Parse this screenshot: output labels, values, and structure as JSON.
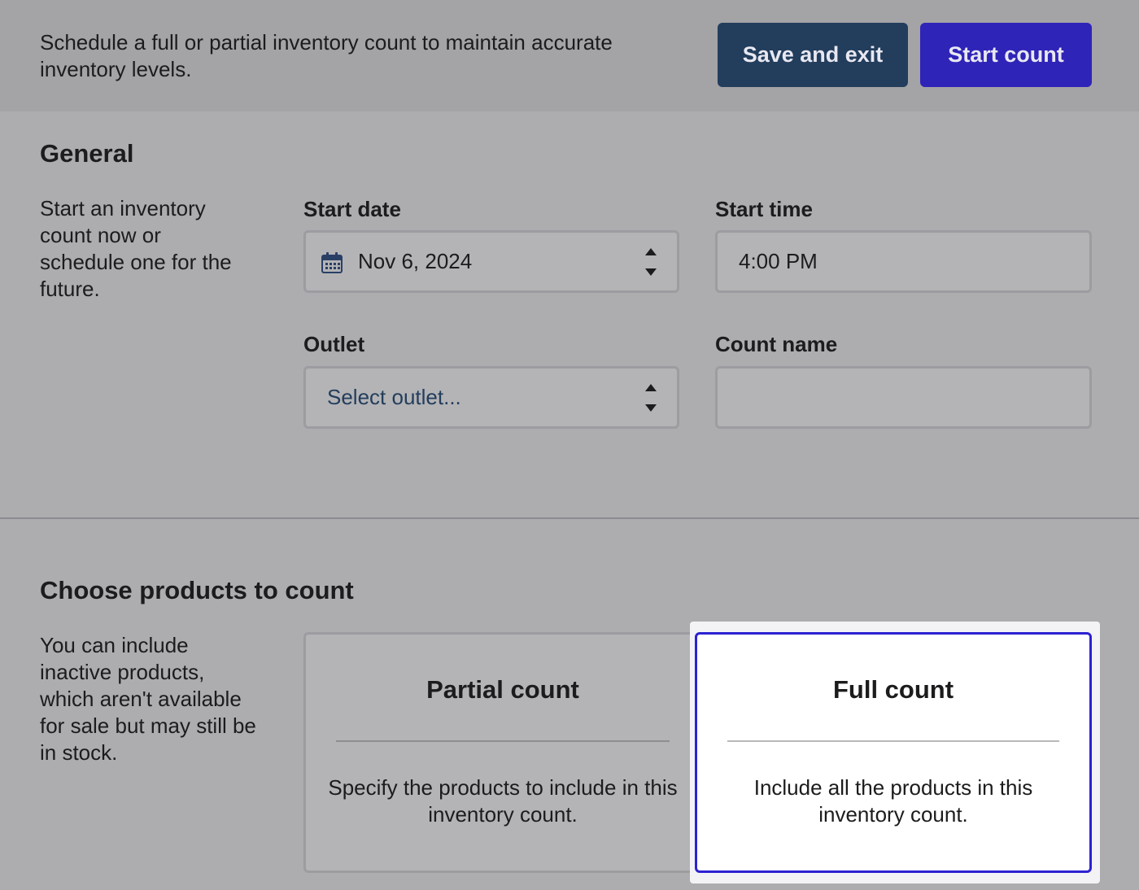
{
  "header": {
    "description": "Schedule a full or partial inventory count to maintain accurate inventory levels.",
    "save_exit_label": "Save and exit",
    "start_count_label": "Start count",
    "save_color": "#233d5c",
    "start_color": "#2f24b8"
  },
  "general": {
    "title": "General",
    "description": "Start an inventory count now or schedule one for the future.",
    "start_date": {
      "label": "Start date",
      "value": "Nov 6, 2024",
      "icon": "calendar-icon"
    },
    "start_time": {
      "label": "Start time",
      "value": "4:00 PM"
    },
    "outlet": {
      "label": "Outlet",
      "placeholder": "Select outlet..."
    },
    "count_name": {
      "label": "Count name",
      "value": ""
    }
  },
  "products": {
    "title": "Choose products to count",
    "description": "You can include inactive products, which aren't available for sale but may still be in stock.",
    "options": [
      {
        "title": "Partial count",
        "description": "Specify the products to include in this inventory count.",
        "selected": false
      },
      {
        "title": "Full count",
        "description": "Include all the products in this inventory count.",
        "selected": true
      }
    ],
    "selected_border_color": "#2c22d1"
  }
}
